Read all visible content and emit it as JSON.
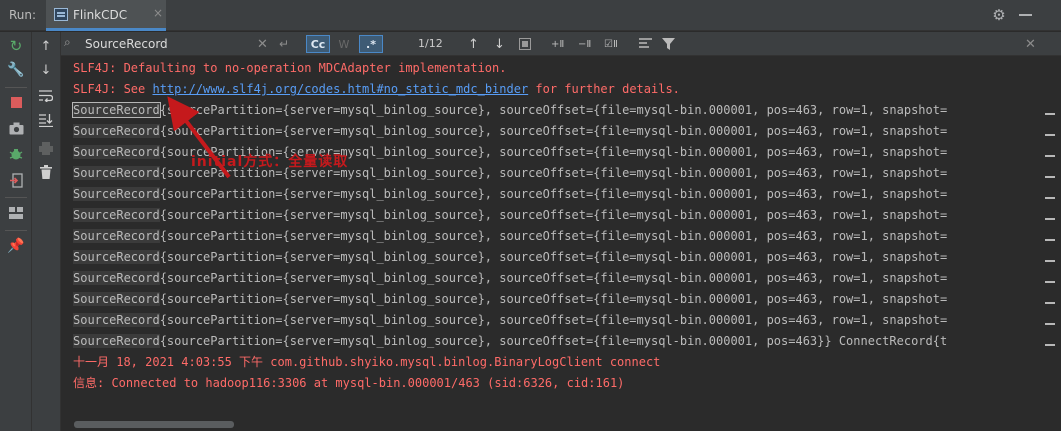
{
  "topbar": {
    "run_label": "Run:",
    "tab_label": "FlinkCDC",
    "tab_close": "×"
  },
  "search": {
    "value": "SourceRecord",
    "match_count": "1/12",
    "case_label": "Cc",
    "words_label": "W",
    "regex_label": ".*"
  },
  "console": {
    "lines": [
      {
        "type": "red",
        "text": "SLF4J: Defaulting to no-operation MDCAdapter implementation."
      },
      {
        "type": "link",
        "prefix": "SLF4J: See ",
        "link": "http://www.slf4j.org/codes.html#no_static_mdc_binder",
        "suffix": " for further details."
      }
    ],
    "record_keyword": "SourceRecord",
    "record_rest": "{sourcePartition={server=mysql_binlog_source}, sourceOffset={file=mysql-bin.000001, pos=463, row=1, snapshot=",
    "record_last_rest": "{sourcePartition={server=mysql_binlog_source}, sourceOffset={file=mysql-bin.000001, pos=463}} ConnectRecord{t",
    "record_count": 12,
    "footer_lines": [
      "十一月 18, 2021 4:03:55 下午 com.github.shyiko.mysql.binlog.BinaryLogClient connect",
      "信息: Connected to hadoop116:3306 at mysql-bin.000001/463 (sid:6326, cid:161)"
    ]
  },
  "annotation": {
    "text": "initial方式：全量读取",
    "color": "#c5191c"
  },
  "colors": {
    "error_text": "#ff6b68",
    "link": "#589df6",
    "accent": "#4a88c7",
    "background": "#2b2b2b"
  }
}
